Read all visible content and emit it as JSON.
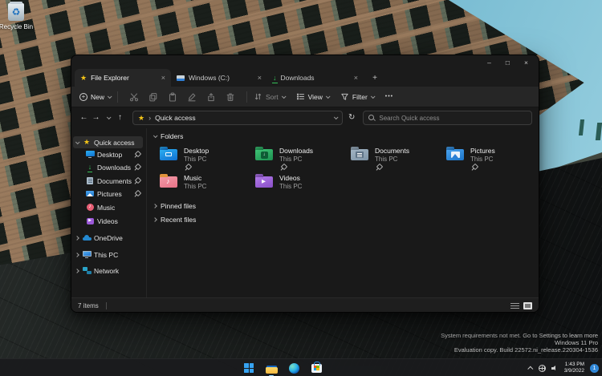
{
  "icons": {
    "star": "★",
    "breadcrumb_sep": "›",
    "back": "←",
    "forward": "→",
    "up": "↑",
    "refresh": "↻",
    "close": "×",
    "add": "+",
    "more": "•••",
    "minimize": "–",
    "maximize": "□",
    "music_note": "♪",
    "play": "▶",
    "down_arrow": "↓",
    "recycle": "♻"
  },
  "desktop": {
    "recycle_bin_label": "Recycle Bin",
    "watermark": {
      "line1": "System requirements not met. Go to Settings to learn more",
      "line2": "Windows 11 Pro",
      "line3": "Evaluation copy. Build 22572.ni_release.220304-1536"
    }
  },
  "window": {
    "tabs": {
      "tab1": "File Explorer",
      "tab2": "Windows (C:)",
      "tab3": "Downloads"
    },
    "toolbar": {
      "new": "New",
      "sort": "Sort",
      "view": "View",
      "filter": "Filter"
    },
    "address": {
      "location": "Quick access",
      "search_placeholder": "Search Quick access"
    },
    "sidebar": {
      "quick_access": "Quick access",
      "desktop": "Desktop",
      "downloads": "Downloads",
      "documents": "Documents",
      "pictures": "Pictures",
      "music": "Music",
      "videos": "Videos",
      "onedrive": "OneDrive",
      "this_pc": "This PC",
      "network": "Network"
    },
    "main": {
      "folders_header": "Folders",
      "pinned_header": "Pinned files",
      "recent_header": "Recent files",
      "tiles": {
        "desktop": {
          "name": "Desktop",
          "location": "This PC"
        },
        "downloads": {
          "name": "Downloads",
          "location": "This PC"
        },
        "documents": {
          "name": "Documents",
          "location": "This PC"
        },
        "pictures": {
          "name": "Pictures",
          "location": "This PC"
        },
        "music": {
          "name": "Music",
          "location": "This PC"
        },
        "videos": {
          "name": "Videos",
          "location": "This PC"
        }
      }
    },
    "status": {
      "items": "7 items"
    }
  },
  "taskbar": {
    "tray": {
      "time": "1:43 PM",
      "date": "3/9/2022",
      "badge": "1"
    }
  },
  "colors": {
    "accent_yellow": "#F5C518",
    "folder_desktop": "#1E9BE9",
    "folder_downloads": "#2EAD62",
    "folder_documents": "#90A5B6",
    "folder_pictures": "#2E8FE6",
    "folder_music": "#EE8A9A",
    "folder_videos": "#A263E0",
    "onedrive_blue": "#2489D0",
    "badge_blue": "#2F86D6",
    "sky": "#5FA9C4"
  }
}
